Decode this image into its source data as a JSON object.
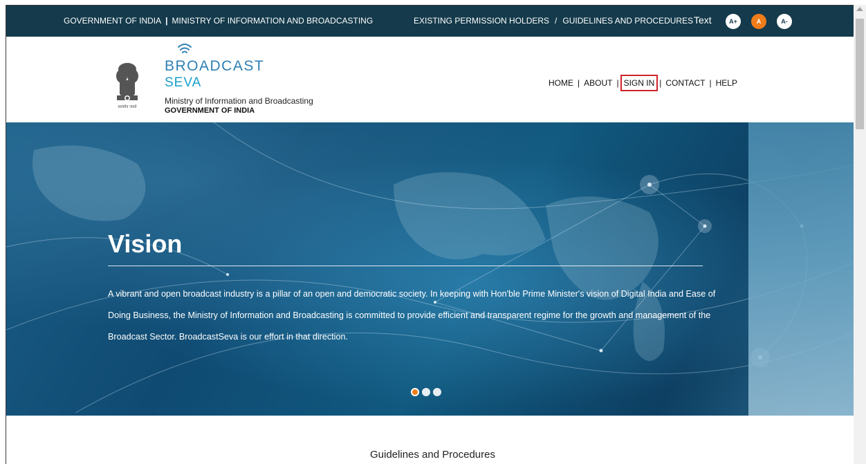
{
  "topbar": {
    "gov": "GOVERNMENT OF INDIA",
    "separator": "|",
    "ministry": "MINISTRY OF INFORMATION AND BROADCASTING",
    "existing": "EXISTING PERMISSION HOLDERS",
    "slash": "/",
    "guidelines": "GUIDELINES AND PROCEDURES",
    "text_label": "Text",
    "font_buttons": [
      "A+",
      "A",
      "A-"
    ]
  },
  "header": {
    "emblem_caption": "सत्यमेव जयते",
    "logo_broadcast": "BROADCAST",
    "logo_seva": "SEVA",
    "ministry_line": "Ministry of Information and Broadcasting",
    "government_line": "GOVERNMENT OF INDIA"
  },
  "nav": {
    "items": [
      "HOME",
      "ABOUT",
      "SIGN IN",
      "CONTACT",
      "HELP"
    ],
    "pipe": "|"
  },
  "hero": {
    "title": "Vision",
    "text": "A vibrant and open broadcast industry is a pillar of an open and democratic society. In keeping with Hon'ble Prime Minister's vision of Digital India and Ease of Doing Business, the Ministry of Information and Broadcasting is committed to provide efficient and transparent regime for the growth and management of the Broadcast Sector. BroadcastSeva is our effort in that direction.",
    "slides": 3,
    "active_slide": 1
  },
  "section": {
    "guidelines_heading": "Guidelines and Procedures"
  },
  "colors": {
    "topbar": "#143a4b",
    "accent": "#f07d1a",
    "signin_highlight": "#d0232a",
    "logo_blue": "#2e7fb3"
  }
}
